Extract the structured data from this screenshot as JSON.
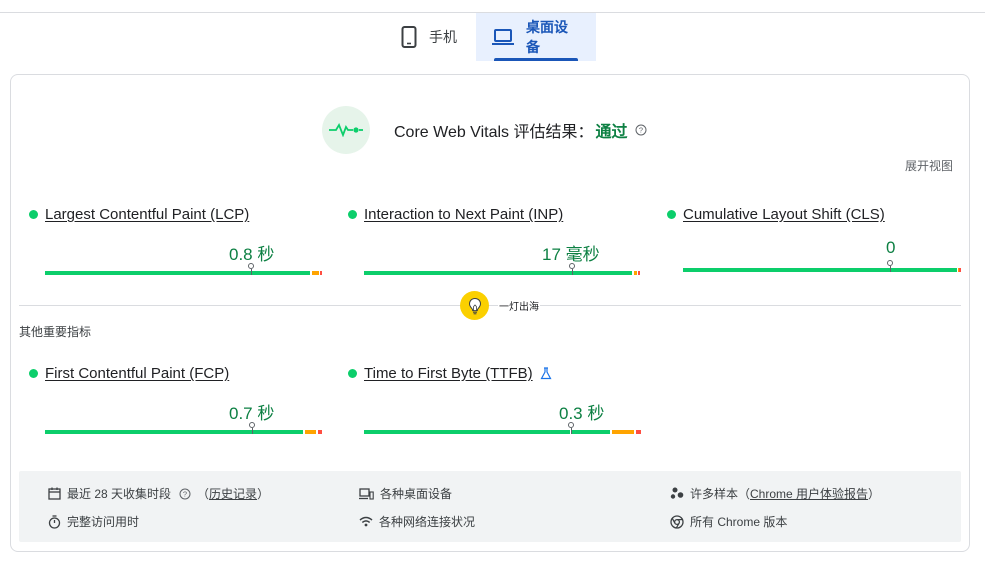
{
  "tabs": [
    {
      "label": "手机",
      "icon": "smartphone-icon",
      "active": false
    },
    {
      "label": "桌面设备",
      "icon": "laptop-icon",
      "active": true
    }
  ],
  "assessment": {
    "title": "Core Web Vitals 评估结果：",
    "status": "通过",
    "expand_label": "展开视图"
  },
  "core_metrics": [
    {
      "name": "Largest Contentful Paint (LCP)",
      "value": "0.8 秒",
      "status": "good"
    },
    {
      "name": "Interaction to Next Paint (INP)",
      "value": "17 毫秒",
      "status": "good"
    },
    {
      "name": "Cumulative Layout Shift (CLS)",
      "value": "0",
      "status": "good"
    }
  ],
  "overlay": {
    "text": "一灯出海"
  },
  "other_metrics_label": "其他重要指标",
  "other_metrics": [
    {
      "name": "First Contentful Paint (FCP)",
      "value": "0.7 秒",
      "status": "good"
    },
    {
      "name": "Time to First Byte (TTFB)",
      "value": "0.3 秒",
      "status": "good",
      "experimental": true
    }
  ],
  "info": {
    "period": "最近 28 天收集时段",
    "history_open": "（",
    "history_link": "历史记录",
    "history_close": "）",
    "devices": "各种桌面设备",
    "samples_prefix": "许多样本（",
    "samples_link": "Chrome 用户体验报告",
    "samples_suffix": "）",
    "duration": "完整访问用时",
    "network": "各种网络连接状况",
    "chrome": "所有 Chrome 版本"
  },
  "colors": {
    "good": "#0cce6b",
    "needs_improvement": "#ffa400",
    "poor": "#ff4e42",
    "pass_text": "#0d8043",
    "accent": "#1a56b8"
  }
}
